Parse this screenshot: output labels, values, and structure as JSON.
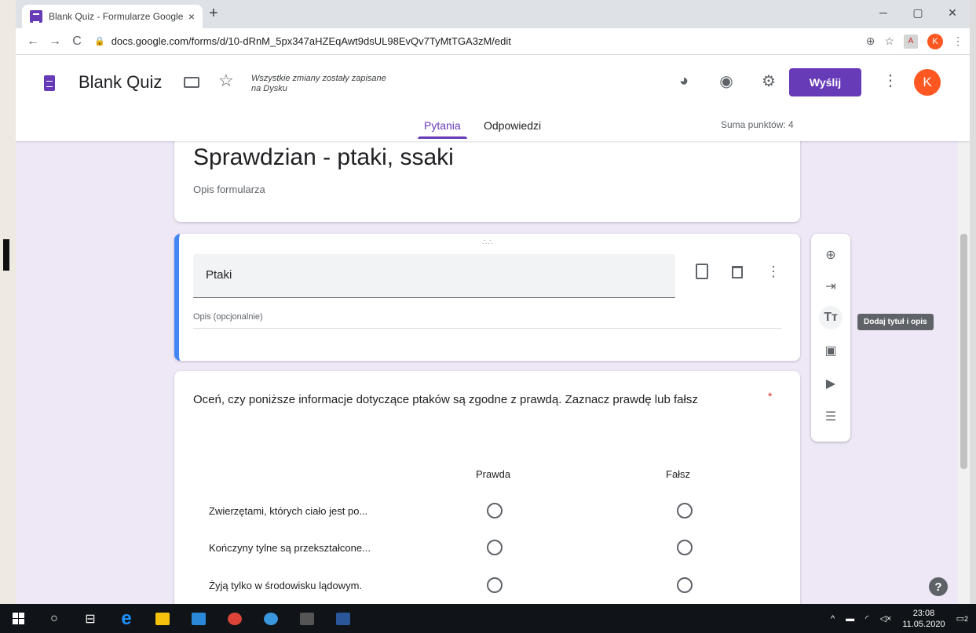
{
  "browser": {
    "tab_title": "Blank Quiz - Formularze Google",
    "tab_close": "×",
    "new_tab": "+",
    "url": "docs.google.com/forms/d/10-dRnM_5px347aHZEqAwt9dsUL98EvQv7TyMtTGA3zM/edit",
    "profile_initial": "K"
  },
  "header": {
    "doc_title": "Blank Quiz",
    "saved_status": "Wszystkie zmiany zostały zapisane na Dysku",
    "send_label": "Wyślij",
    "avatar_initial": "K",
    "tabs": [
      "Pytania",
      "Odpowiedzi"
    ],
    "total_points": "Suma punktów: 4"
  },
  "form": {
    "title": "Sprawdzian - ptaki, ssaki",
    "description": "Opis formularza"
  },
  "section": {
    "title": "Ptaki",
    "description_placeholder": "Opis (opcjonalnie)"
  },
  "question": {
    "text": "Oceń, czy poniższe informacje dotyczące ptaków są zgodne z prawdą. Zaznacz prawdę lub fałsz",
    "required_mark": "*",
    "columns": [
      "Prawda",
      "Fałsz"
    ],
    "rows": [
      "Zwierzętami, których ciało jest po...",
      "Kończyny tylne są przekształcone...",
      "Żyją tylko w środowisku lądowym."
    ]
  },
  "side_toolbar": {
    "tooltip": "Dodaj tytuł i opis"
  },
  "taskbar": {
    "time": "23:08",
    "date": "11.05.2020",
    "notifications": "2"
  },
  "colors": {
    "accent": "#673ab7",
    "section_bar": "#4285f4",
    "background": "#ede7f6",
    "required": "#d93025"
  }
}
